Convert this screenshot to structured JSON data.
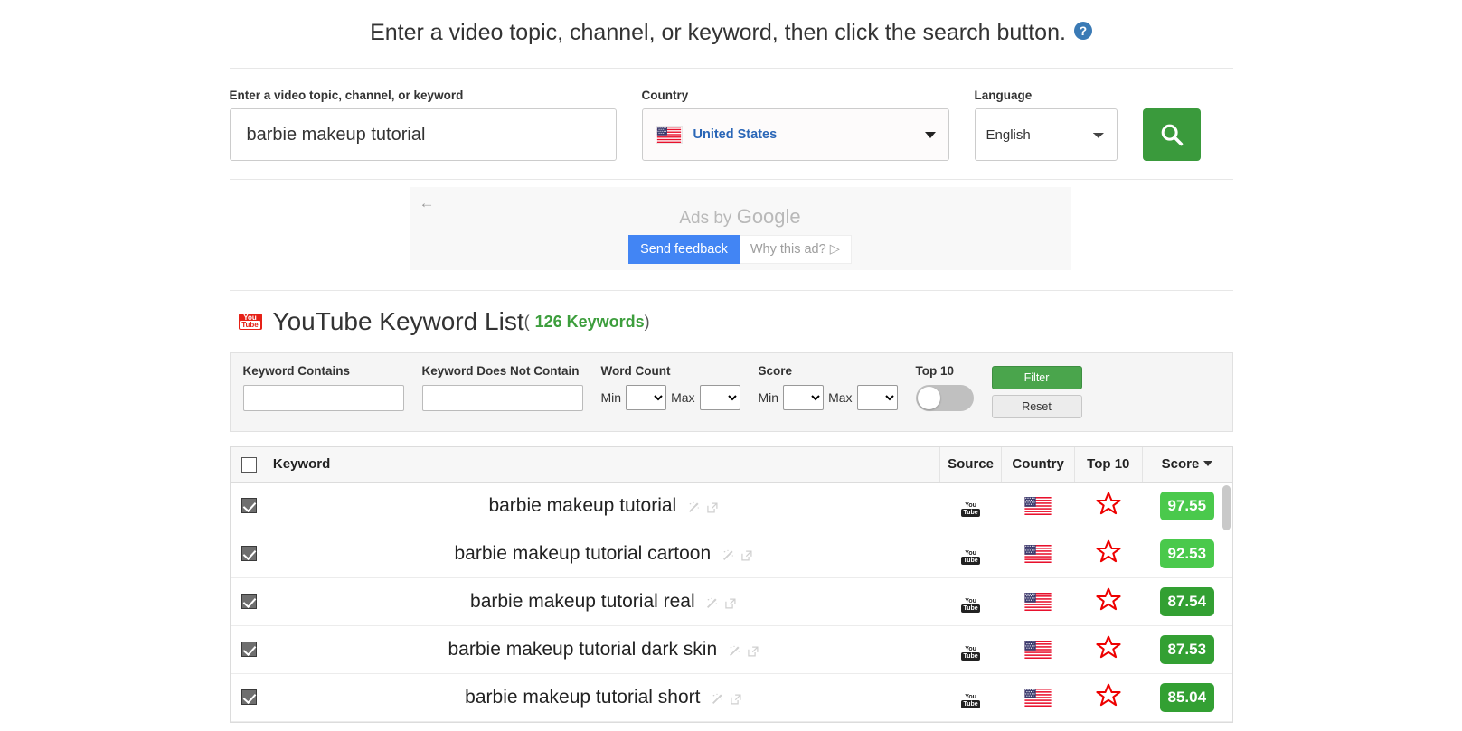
{
  "instruction": {
    "text": "Enter a video topic, channel, or keyword, then click the search button.",
    "help_icon": "help-circle-icon",
    "help_label": "?"
  },
  "search": {
    "keyword_label": "Enter a video topic, channel, or keyword",
    "keyword_value": "barbie makeup tutorial",
    "keyword_placeholder": "",
    "country_label": "Country",
    "country_value": "United States",
    "country_flag": "us-flag-icon",
    "language_label": "Language",
    "language_value": "English",
    "search_button_icon": "search-icon"
  },
  "ads": {
    "back_icon": "back-arrow-icon",
    "label_prefix": "Ads by ",
    "label_brand": "Google",
    "send_feedback": "Send feedback",
    "why_this_ad": "Why this ad? ▷"
  },
  "list_header": {
    "logo": "youtube-logo-icon",
    "logo_top": "You",
    "logo_bottom": "Tube",
    "title": "YouTube Keyword List",
    "open_paren": "(",
    "count_text": "126 Keywords",
    "close_paren": ")"
  },
  "filters": {
    "contains_label": "Keyword Contains",
    "contains_value": "",
    "notcontains_label": "Keyword Does Not Contain",
    "notcontains_value": "",
    "wordcount_label": "Word Count",
    "wordcount_min_prefix": "Min",
    "wordcount_max_prefix": "Max",
    "wordcount_min_value": "",
    "wordcount_max_value": "",
    "score_label": "Score",
    "score_min_prefix": "Min",
    "score_max_prefix": "Max",
    "score_min_value": "",
    "score_max_value": "",
    "top10_label": "Top 10",
    "top10_enabled": false,
    "filter_button": "Filter",
    "reset_button": "Reset"
  },
  "table": {
    "columns": {
      "select_all": "",
      "keyword": "Keyword",
      "source": "Source",
      "country": "Country",
      "top10": "Top 10",
      "score": "Score"
    },
    "sort_column": "Score",
    "sort_direction": "desc",
    "select_all_checked": false,
    "rows": [
      {
        "checked": true,
        "keyword": "barbie makeup tutorial",
        "source": "YouTube",
        "country": "United States",
        "top10": true,
        "score": "97.55",
        "score_color": "#4ac94c"
      },
      {
        "checked": true,
        "keyword": "barbie makeup tutorial cartoon",
        "source": "YouTube",
        "country": "United States",
        "top10": true,
        "score": "92.53",
        "score_color": "#4ac94c"
      },
      {
        "checked": true,
        "keyword": "barbie makeup tutorial real",
        "source": "YouTube",
        "country": "United States",
        "top10": true,
        "score": "87.54",
        "score_color": "#33a033"
      },
      {
        "checked": true,
        "keyword": "barbie makeup tutorial dark skin",
        "source": "YouTube",
        "country": "United States",
        "top10": true,
        "score": "87.53",
        "score_color": "#33a033"
      },
      {
        "checked": true,
        "keyword": "barbie makeup tutorial short",
        "source": "YouTube",
        "country": "United States",
        "top10": true,
        "score": "85.04",
        "score_color": "#33a033"
      }
    ],
    "row_icons": [
      "magic-wand-icon",
      "external-link-icon"
    ]
  },
  "colors": {
    "brand_green": "#3a9a3c",
    "accent_blue": "#2a66b7",
    "count_green": "#3d9e3d",
    "star_red": "#ee0000"
  }
}
